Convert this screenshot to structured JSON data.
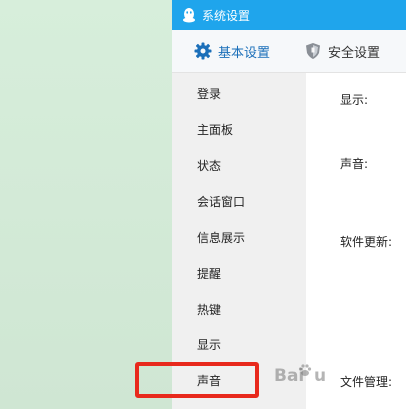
{
  "window": {
    "title": "系统设置"
  },
  "tabs": [
    {
      "label": "基本设置",
      "icon": "gear-icon",
      "active": true
    },
    {
      "label": "安全设置",
      "icon": "shield-icon",
      "active": false
    }
  ],
  "sidebar": {
    "items": [
      {
        "label": "登录"
      },
      {
        "label": "主面板"
      },
      {
        "label": "状态"
      },
      {
        "label": "会话窗口"
      },
      {
        "label": "信息展示"
      },
      {
        "label": "提醒"
      },
      {
        "label": "热键"
      },
      {
        "label": "显示"
      },
      {
        "label": "声音"
      }
    ]
  },
  "content": {
    "sections": [
      {
        "label": "显示:"
      },
      {
        "label": "声音:"
      },
      {
        "label": "软件更新:"
      },
      {
        "label": "文件管理:"
      }
    ]
  },
  "watermark": {
    "text": "Bai",
    "text2": "u"
  },
  "colors": {
    "titlebar": "#1fa5ec",
    "active_tab_text": "#1b6fb9",
    "highlight": "#e8291c",
    "desktop": "#d3ead6"
  }
}
